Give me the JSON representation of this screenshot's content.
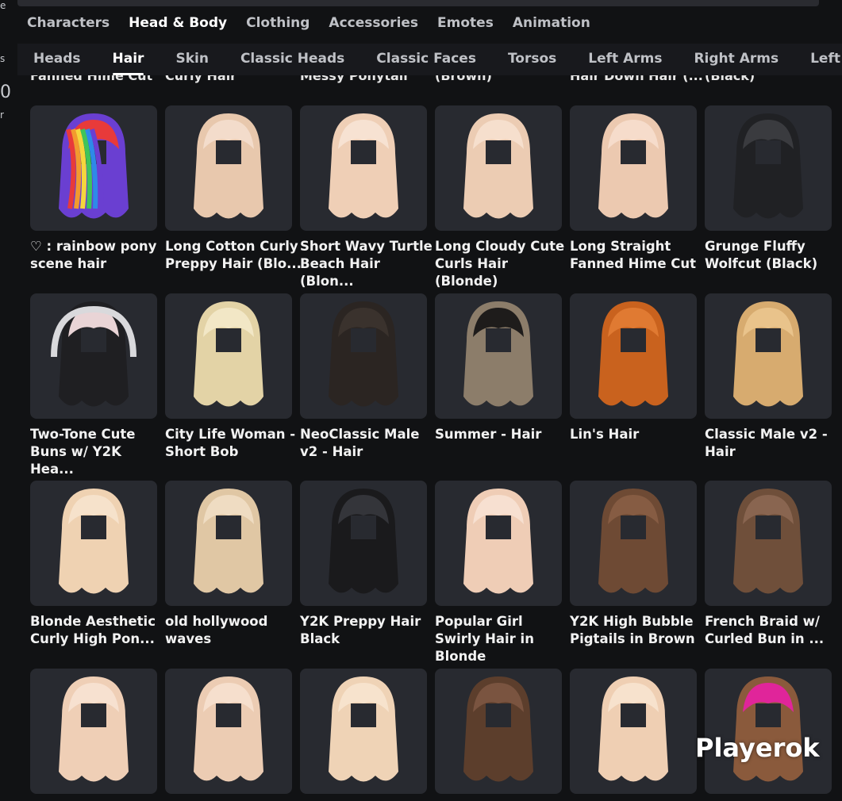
{
  "topbar": {
    "tabs": [
      {
        "label": "Characters",
        "active": false
      },
      {
        "label": "Head & Body",
        "active": true
      },
      {
        "label": "Clothing",
        "active": false
      },
      {
        "label": "Accessories",
        "active": false
      },
      {
        "label": "Emotes",
        "active": false
      },
      {
        "label": "Animation",
        "active": false
      }
    ]
  },
  "subtabs": [
    {
      "label": "Heads",
      "active": false
    },
    {
      "label": "Hair",
      "active": true
    },
    {
      "label": "Skin",
      "active": false
    },
    {
      "label": "Classic Heads",
      "active": false
    },
    {
      "label": "Classic Faces",
      "active": false
    },
    {
      "label": "Torsos",
      "active": false
    },
    {
      "label": "Left Arms",
      "active": false
    },
    {
      "label": "Right Arms",
      "active": false
    },
    {
      "label": "Left Legs",
      "active": false
    }
  ],
  "left_edge": [
    "e",
    "s",
    "0",
    "r"
  ],
  "clipped_row": [
    "Fanned Hime Cut",
    "Curly Hair",
    "Messy Ponytail",
    "(Brown)",
    "Hair Down Hair (...",
    "(Black)"
  ],
  "items": [
    {
      "name": "♡ : rainbow pony scene hair",
      "icon": "rainbow-hair-icon",
      "color": "#6a3fd1",
      "accent": "#e83a3a"
    },
    {
      "name": "Long Cotton Curly Preppy Hair (Blo...",
      "icon": "curly-hair-icon",
      "color": "#e8c8ad",
      "accent": "#f3dccb"
    },
    {
      "name": "Short Wavy Turtle Beach Hair (Blon...",
      "icon": "wavy-hair-icon",
      "color": "#efcfb6",
      "accent": "#f7e2d2"
    },
    {
      "name": "Long Cloudy Cute Curls Hair (Blonde)",
      "icon": "long-hair-icon",
      "color": "#ecccb3",
      "accent": "#f6dfcd"
    },
    {
      "name": "Long Straight Fanned Hime Cut",
      "icon": "straight-hair-icon",
      "color": "#ecc9b0",
      "accent": "#f6dccb"
    },
    {
      "name": "Grunge Fluffy Wolfcut (Black)",
      "icon": "wolfcut-hair-icon",
      "color": "#202124",
      "accent": "#3a3b3f"
    },
    {
      "name": "Two-Tone Cute Buns w/ Y2K Hea...",
      "icon": "headphones-hair-icon",
      "color": "#1f1f22",
      "accent": "#e9d4d6"
    },
    {
      "name": "City Life Woman - Short Bob",
      "icon": "bob-hair-icon",
      "color": "#e3d3a6",
      "accent": "#f2e7c6"
    },
    {
      "name": "NeoClassic Male v2 - Hair",
      "icon": "male-hair-icon",
      "color": "#2b2522",
      "accent": "#3a322d"
    },
    {
      "name": "Summer - Hair",
      "icon": "summer-hair-icon",
      "color": "#8c7d6a",
      "accent": "#1e1c1b"
    },
    {
      "name": "Lin's Hair",
      "icon": "lins-hair-icon",
      "color": "#c9621e",
      "accent": "#e07a32"
    },
    {
      "name": "Classic Male v2 - Hair",
      "icon": "spiky-hair-icon",
      "color": "#d7ab6f",
      "accent": "#e9c38b"
    },
    {
      "name": "Blonde Aesthetic Curly High Pon...",
      "icon": "ponytail-hair-icon",
      "color": "#efd2b2",
      "accent": "#f6e2cb"
    },
    {
      "name": "old hollywood waves",
      "icon": "waves-hair-icon",
      "color": "#e0c7a4",
      "accent": "#efdcc2"
    },
    {
      "name": "Y2K Preppy Hair Black",
      "icon": "black-hair-icon",
      "color": "#1a1a1c",
      "accent": "#34353a"
    },
    {
      "name": "Popular Girl Swirly Hair in Blonde",
      "icon": "swirly-hair-icon",
      "color": "#efcdb6",
      "accent": "#f7e0d1"
    },
    {
      "name": "Y2K High Bubble Pigtails in Brown",
      "icon": "pigtails-hair-icon",
      "color": "#6e4a34",
      "accent": "#865c43"
    },
    {
      "name": "French Braid w/ Curled Bun in ...",
      "icon": "braid-hair-icon",
      "color": "#6f4f3a",
      "accent": "#896550"
    },
    {
      "name": "",
      "icon": "bun-hair-icon",
      "color": "#efcfb6",
      "accent": "#f7e1d0"
    },
    {
      "name": "",
      "icon": "headband-hair-icon",
      "color": "#ecccb3",
      "accent": "#f6dfcd"
    },
    {
      "name": "",
      "icon": "side-braid-hair-icon",
      "color": "#efd3b6",
      "accent": "#f7e3cd"
    },
    {
      "name": "",
      "icon": "updo-hair-icon",
      "color": "#5c3e2c",
      "accent": "#7a5440"
    },
    {
      "name": "",
      "icon": "half-up-hair-icon",
      "color": "#efcfb3",
      "accent": "#f7e2cd"
    },
    {
      "name": "",
      "icon": "rollers-hair-icon",
      "color": "#8a5a3c",
      "accent": "#e0259a"
    }
  ],
  "watermark": "Playerok"
}
